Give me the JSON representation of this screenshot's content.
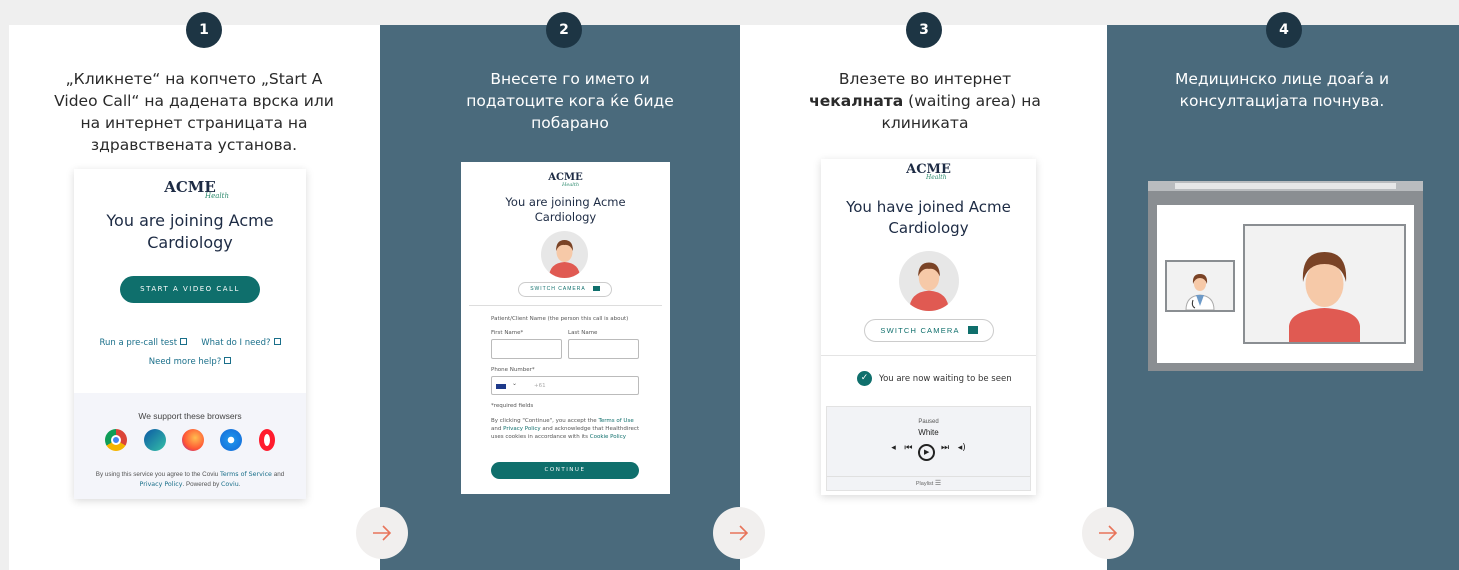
{
  "steps": [
    {
      "num": "1",
      "desc": "„Кликнете“ на копчето „Start A Video Call“ на дадената врска или на интернет страницата на здравствената установа."
    },
    {
      "num": "2",
      "desc": "Внесете го името и податоците кога ќе биде побарано"
    },
    {
      "num": "3",
      "desc_prefix": "Влезете во интернет",
      "desc_bold": "чекалната",
      "desc_suffix": "(waiting area) на клиниката"
    },
    {
      "num": "4",
      "desc": "Медицинско лице доаѓа и консултацијата почнува."
    }
  ],
  "logo": {
    "main": "ACME",
    "sub": "Health"
  },
  "card1": {
    "title": "You are joining Acme Cardiology",
    "button": "START A VIDEO CALL",
    "links": [
      "Run a pre-call test",
      "What do I need?",
      "Need more help?"
    ],
    "browsers_heading": "We support these browsers",
    "footer_pre": "By using this service you agree to the Coviu",
    "footer_terms": "Terms of Service",
    "footer_and": "and",
    "footer_privacy": "Privacy Policy",
    "footer_powered": ". Powered by",
    "footer_coviu": "Coviu"
  },
  "card2": {
    "title": "You are joining Acme Cardiology",
    "switch_camera": "SWITCH CAMERA",
    "patient_label": "Patient/Client Name (the person this call is about)",
    "first_name": "First Name*",
    "last_name": "Last Name",
    "phone_label": "Phone Number*",
    "phone_code": "+61",
    "required": "*required fields",
    "legal_1": "By clicking \"Continue\", you accept the",
    "legal_terms": "Terms of Use",
    "legal_and": "and",
    "legal_privacy": "Privacy Policy",
    "legal_2": "and acknowledge that Healthdirect uses cookies in accordance with its",
    "legal_cookie": "Cookie Policy",
    "continue": "CONTINUE"
  },
  "card3": {
    "title": "You have joined Acme Cardiology",
    "switch_camera": "SWITCH CAMERA",
    "waiting": "You are now waiting to be seen",
    "player_status": "Paused",
    "player_track": "White",
    "playlist": "Playlist"
  },
  "colors": {
    "teal": "#0f6f6c",
    "panel_dark": "#4a6a7c",
    "step_badge": "#1d3544",
    "arrow_orange": "#e8745a",
    "avatar_shirt": "#e05a52",
    "avatar_skin": "#f6c9a8",
    "avatar_hair": "#7a4326"
  }
}
